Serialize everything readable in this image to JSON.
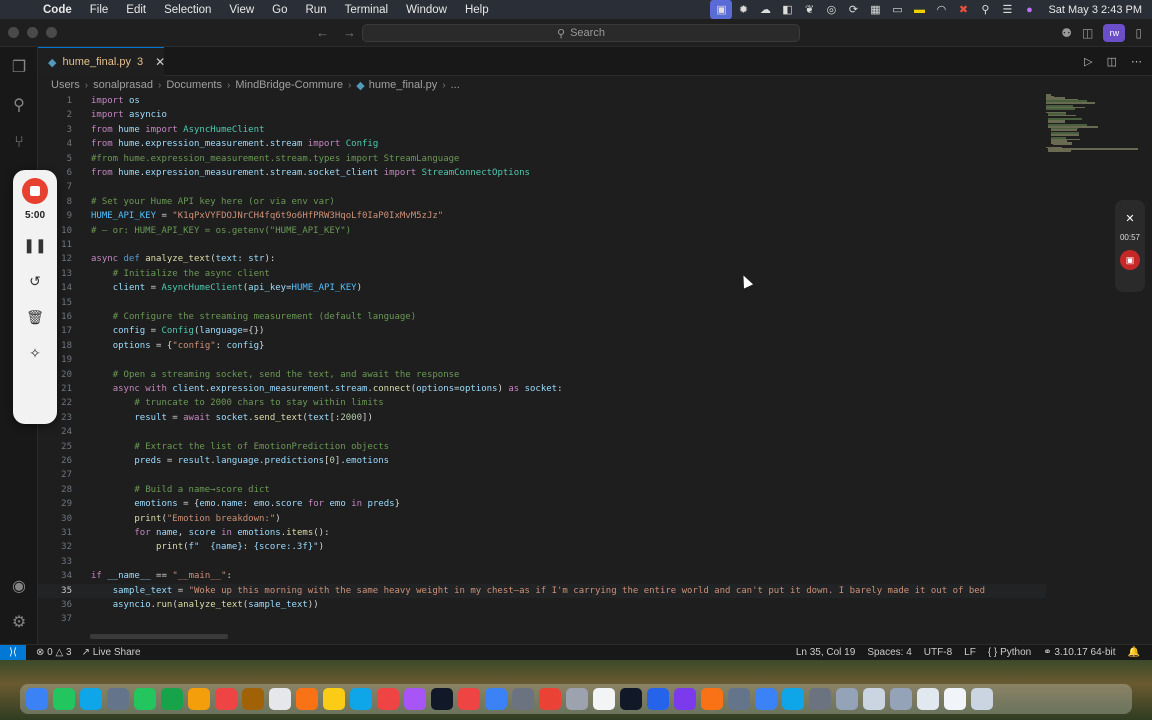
{
  "menubar": {
    "app": "Code",
    "items": [
      "File",
      "Edit",
      "Selection",
      "View",
      "Go",
      "Run",
      "Terminal",
      "Window",
      "Help"
    ],
    "clock": "Sat May 3  2:43 PM"
  },
  "titlebar": {
    "search_placeholder": "Search",
    "rw_badge": "rw"
  },
  "tab": {
    "name": "hume_final.py",
    "badge": "3"
  },
  "breadcrumb": [
    "Users",
    "sonalprasad",
    "Documents",
    "MindBridge-Commure",
    "hume_final.py",
    "..."
  ],
  "recorder": {
    "time": "5:00"
  },
  "right_widget": {
    "time": "00:57"
  },
  "editor": {
    "current_line": 35,
    "lines": [
      {
        "n": "1",
        "t": "import os"
      },
      {
        "n": "2",
        "t": "import asyncio"
      },
      {
        "n": "3",
        "t": "from hume import AsyncHumeClient"
      },
      {
        "n": "4",
        "t": "from hume.expression_measurement.stream import Config"
      },
      {
        "n": "5",
        "t": "#from hume.expression_measurement.stream.types import StreamLanguage"
      },
      {
        "n": "6",
        "t": "from hume.expression_measurement.stream.socket_client import StreamConnectOptions"
      },
      {
        "n": "7",
        "t": ""
      },
      {
        "n": "8",
        "t": "# Set your Hume API key here (or via env var)"
      },
      {
        "n": "9",
        "t": "HUME_API_KEY = \"K1qPxVYFDOJNrCH4fq6t9o6HfPRW3HqoLf0IaP0IxMvM5zJz\""
      },
      {
        "n": "10",
        "t": "# — or: HUME_API_KEY = os.getenv(\"HUME_API_KEY\")"
      },
      {
        "n": "11",
        "t": ""
      },
      {
        "n": "12",
        "t": "async def analyze_text(text: str):"
      },
      {
        "n": "13",
        "t": "    # Initialize the async client"
      },
      {
        "n": "14",
        "t": "    client = AsyncHumeClient(api_key=HUME_API_KEY)"
      },
      {
        "n": "15",
        "t": ""
      },
      {
        "n": "16",
        "t": "    # Configure the streaming measurement (default language)"
      },
      {
        "n": "17",
        "t": "    config = Config(language={})"
      },
      {
        "n": "18",
        "t": "    options = {\"config\": config}"
      },
      {
        "n": "19",
        "t": ""
      },
      {
        "n": "20",
        "t": "    # Open a streaming socket, send the text, and await the response"
      },
      {
        "n": "21",
        "t": "    async with client.expression_measurement.stream.connect(options=options) as socket:"
      },
      {
        "n": "22",
        "t": "        # truncate to 2000 chars to stay within limits"
      },
      {
        "n": "23",
        "t": "        result = await socket.send_text(text[:2000])"
      },
      {
        "n": "24",
        "t": ""
      },
      {
        "n": "25",
        "t": "        # Extract the list of EmotionPrediction objects"
      },
      {
        "n": "26",
        "t": "        preds = result.language.predictions[0].emotions"
      },
      {
        "n": "27",
        "t": ""
      },
      {
        "n": "28",
        "t": "        # Build a name→score dict"
      },
      {
        "n": "29",
        "t": "        emotions = {emo.name: emo.score for emo in preds}"
      },
      {
        "n": "30",
        "t": "        print(\"Emotion breakdown:\")"
      },
      {
        "n": "31",
        "t": "        for name, score in emotions.items():"
      },
      {
        "n": "32",
        "t": "            print(f\"  {name}: {score:.3f}\")"
      },
      {
        "n": "33",
        "t": ""
      },
      {
        "n": "34",
        "t": "if __name__ == \"__main__\":"
      },
      {
        "n": "35",
        "t": "    sample_text = \"Woke up this morning with the same heavy weight in my chest—as if I'm carrying the entire world and can't put it down. I barely made it out of bed"
      },
      {
        "n": "36",
        "t": "    asyncio.run(analyze_text(sample_text))"
      },
      {
        "n": "37",
        "t": ""
      }
    ]
  },
  "statusbar": {
    "errors": "0",
    "warnings": "3",
    "live_share": "Live Share",
    "position": "Ln 35, Col 19",
    "spaces": "Spaces: 4",
    "encoding": "UTF-8",
    "eol": "LF",
    "language": "Python",
    "interpreter": "3.10.17 64-bit"
  },
  "colors": {
    "accent": "#0078d4",
    "record_red": "#e8402f"
  }
}
